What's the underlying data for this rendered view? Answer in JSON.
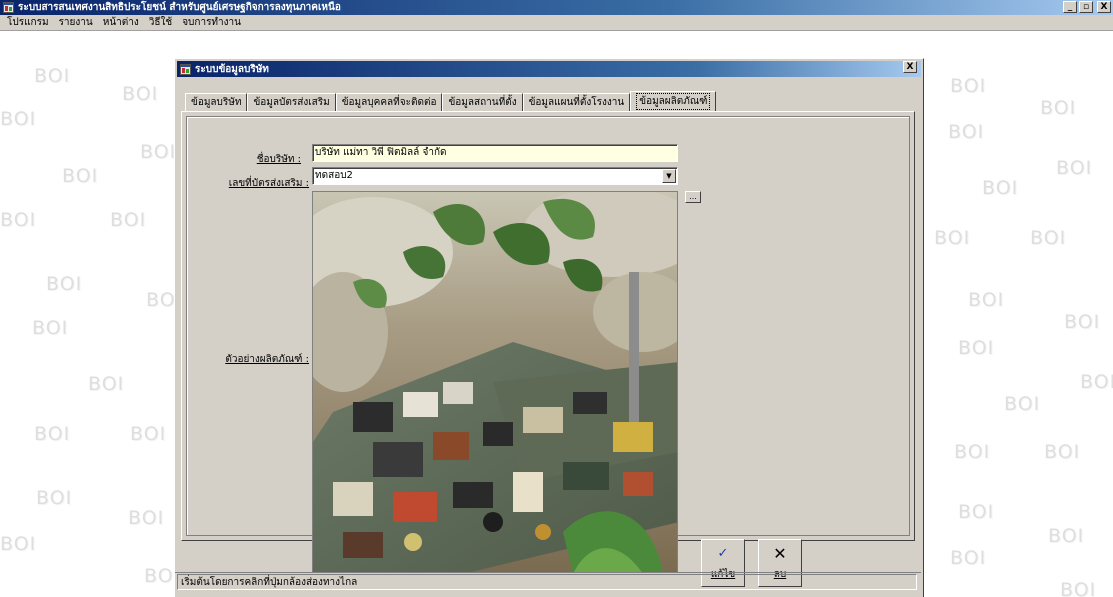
{
  "app": {
    "title": "ระบบสารสนเทศงานสิทธิประโยชน์ สำหรับศูนย์เศรษฐกิจการลงทุนภาคเหนือ",
    "minimize": "_",
    "maximize": "▫",
    "close": "X"
  },
  "menu": {
    "items": [
      {
        "label": "โปรแกรม"
      },
      {
        "label": "รายงาน"
      },
      {
        "label": "หน้าต่าง"
      },
      {
        "label": "วิธีใช้"
      },
      {
        "label": "จบการทำงาน"
      }
    ]
  },
  "watermark": {
    "text": "BOI"
  },
  "dialog": {
    "title": "ระบบข้อมูลบริษัท",
    "close": "X",
    "tabs": [
      {
        "label": "ข้อมูลบริษัท"
      },
      {
        "label": "ข้อมูลบัตรส่งเสริม"
      },
      {
        "label": "ข้อมูลบุคคลที่จะติดต่อ"
      },
      {
        "label": "ข้อมูลสถานที่ตั้ง"
      },
      {
        "label": "ข้อมูลแผนที่ตั้งโรงงาน"
      },
      {
        "label": "ข้อมูลผลิตภัณฑ์"
      }
    ],
    "active_tab": "ข้อมูลผลิตภัณฑ์",
    "company_label": "ชื่อบริษัท :",
    "company_value": "บริษัท แม่ทา วิพี ฟิตมิลล์ จำกัด",
    "cert_label": "เลขที่บัตรส่งเสริม :",
    "cert_value": "ทดสอบ2",
    "browse_label": "...",
    "sample_label": "ตัวอย่างผลิตภัณฑ์ :",
    "edit_label": "แก้ไข",
    "delete_label": "ลบ",
    "status_text": "เริ่มต้นโดยการคลิกที่ปุ่มกล้องส่องทางไกล"
  },
  "colors": {
    "titlebar_start": "#0a246a",
    "face": "#d4d0c8",
    "company_field_bg": "#ffffe1",
    "watermark": "#dedede"
  },
  "icons": {
    "app": "app-window-icon",
    "edit": "spellcheck-icon",
    "delete": "x-icon"
  }
}
